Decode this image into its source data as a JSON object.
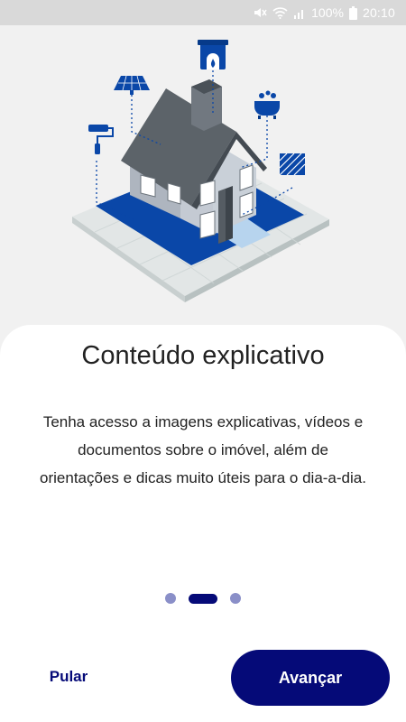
{
  "status_bar": {
    "battery": "100%",
    "time": "20:10"
  },
  "icons": {
    "mute": "mute-icon",
    "wifi": "wifi-icon",
    "signal": "signal-icon",
    "battery": "battery-icon",
    "house": "house-illustration-icon",
    "fireplace": "fireplace-icon",
    "solar_panel": "solar-panel-icon",
    "bathtub": "bathtub-icon",
    "paint_roller": "paint-roller-icon",
    "wall_texture": "wall-texture-icon"
  },
  "onboarding": {
    "title": "Conteúdo explicativo",
    "description": "Tenha acesso a imagens explicativas, vídeos e documentos sobre o imóvel, além de orientações e dicas muito úteis para o dia-a-dia.",
    "page_indicator": {
      "total": 3,
      "current": 2
    }
  },
  "actions": {
    "skip_label": "Pular",
    "next_label": "Avançar"
  },
  "colors": {
    "primary": "#050a78",
    "dot_inactive": "#8a8fc8",
    "blueprint": "#0a47a8"
  }
}
